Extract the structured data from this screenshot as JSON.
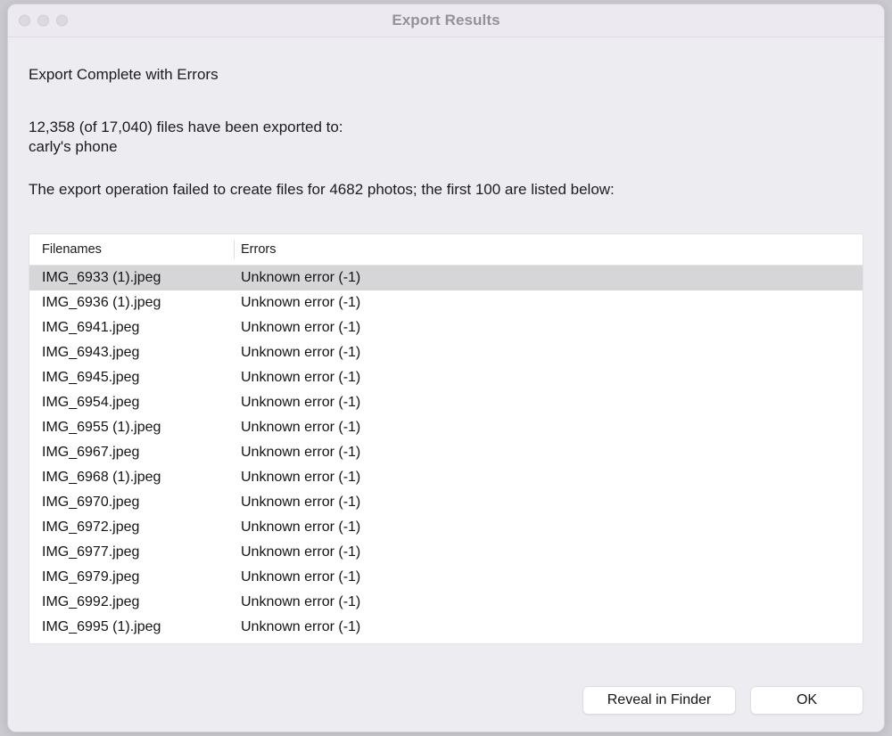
{
  "window": {
    "title": "Export Results",
    "traffic_lights": [
      {
        "name": "close-button",
        "color": "#dcdadf"
      },
      {
        "name": "minimize-button",
        "color": "#dcdadf"
      },
      {
        "name": "maximize-button",
        "color": "#dcdadf"
      }
    ]
  },
  "content": {
    "heading": "Export Complete with Errors",
    "summary_line_1": "12,358 (of 17,040) files have been exported to:",
    "summary_line_2": "carly's phone",
    "failure_note": "The export operation failed to create files for 4682 photos; the first 100 are listed below:"
  },
  "table": {
    "columns": [
      "Filenames",
      "Errors"
    ],
    "selected_row_index": 0,
    "rows": [
      {
        "filename": "IMG_6933 (1).jpeg",
        "error": "Unknown error (-1)"
      },
      {
        "filename": "IMG_6936 (1).jpeg",
        "error": "Unknown error (-1)"
      },
      {
        "filename": "IMG_6941.jpeg",
        "error": "Unknown error (-1)"
      },
      {
        "filename": "IMG_6943.jpeg",
        "error": "Unknown error (-1)"
      },
      {
        "filename": "IMG_6945.jpeg",
        "error": "Unknown error (-1)"
      },
      {
        "filename": "IMG_6954.jpeg",
        "error": "Unknown error (-1)"
      },
      {
        "filename": "IMG_6955 (1).jpeg",
        "error": "Unknown error (-1)"
      },
      {
        "filename": "IMG_6967.jpeg",
        "error": "Unknown error (-1)"
      },
      {
        "filename": "IMG_6968 (1).jpeg",
        "error": "Unknown error (-1)"
      },
      {
        "filename": "IMG_6970.jpeg",
        "error": "Unknown error (-1)"
      },
      {
        "filename": "IMG_6972.jpeg",
        "error": "Unknown error (-1)"
      },
      {
        "filename": "IMG_6977.jpeg",
        "error": "Unknown error (-1)"
      },
      {
        "filename": "IMG_6979.jpeg",
        "error": "Unknown error (-1)"
      },
      {
        "filename": "IMG_6992.jpeg",
        "error": "Unknown error (-1)"
      },
      {
        "filename": "IMG_6995 (1).jpeg",
        "error": "Unknown error (-1)"
      }
    ]
  },
  "footer": {
    "reveal_label": "Reveal in Finder",
    "ok_label": "OK"
  },
  "colors": {
    "window_background": "#edecf1",
    "titlebar_background": "#eceaf0",
    "title_text": "#93919a",
    "table_background": "#ffffff",
    "selected_row": "#d6d5d8",
    "text": "#1c1c1e"
  }
}
